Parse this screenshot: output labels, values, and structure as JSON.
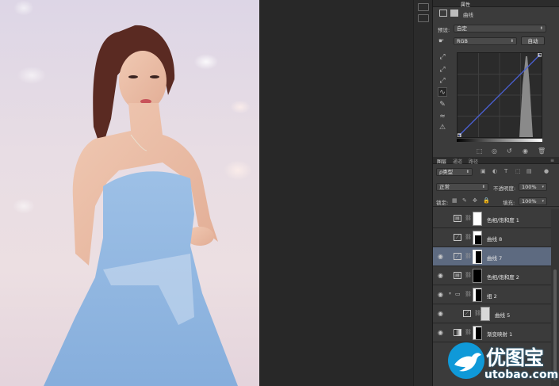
{
  "properties_panel": {
    "tabs": [
      "",
      "",
      "属性"
    ],
    "title": "曲线",
    "preset_label": "预设:",
    "preset_value": "自定",
    "channel_value": "RGB",
    "auto_button": "自动"
  },
  "layers_panel": {
    "tabs": [
      "图层",
      "通道",
      "路径"
    ],
    "filter_value": "ρ类型",
    "blend_mode": "正常",
    "opacity_label": "不透明度:",
    "opacity_value": "100%",
    "lock_label": "锁定:",
    "fill_label": "填充:",
    "fill_value": "100%",
    "layers": [
      {
        "name": "色相/饱和度 1",
        "type": "hue-saturation",
        "visible": false,
        "mask": "white"
      },
      {
        "name": "曲线 8",
        "type": "curves",
        "visible": false,
        "mask": "figure"
      },
      {
        "name": "曲线 7",
        "type": "curves",
        "visible": true,
        "mask": "figure",
        "selected": true
      },
      {
        "name": "色相/饱和度 2",
        "type": "hue-saturation",
        "visible": true,
        "mask": "small"
      },
      {
        "name": "组 2",
        "type": "group",
        "visible": true,
        "mask": "figure"
      },
      {
        "name": "曲线 5",
        "type": "curves",
        "visible": true,
        "mask": "light"
      },
      {
        "name": "渐变映射 1",
        "type": "gradient-map",
        "visible": true,
        "mask": "figure"
      }
    ]
  },
  "watermark": {
    "title": "优图宝",
    "url": "utobao.com"
  },
  "colors": {
    "panel_bg": "#3b3b3b",
    "selected_row": "#5d6a80",
    "canvas_bg": "#282828",
    "brand_blue": "#0f99d8"
  }
}
